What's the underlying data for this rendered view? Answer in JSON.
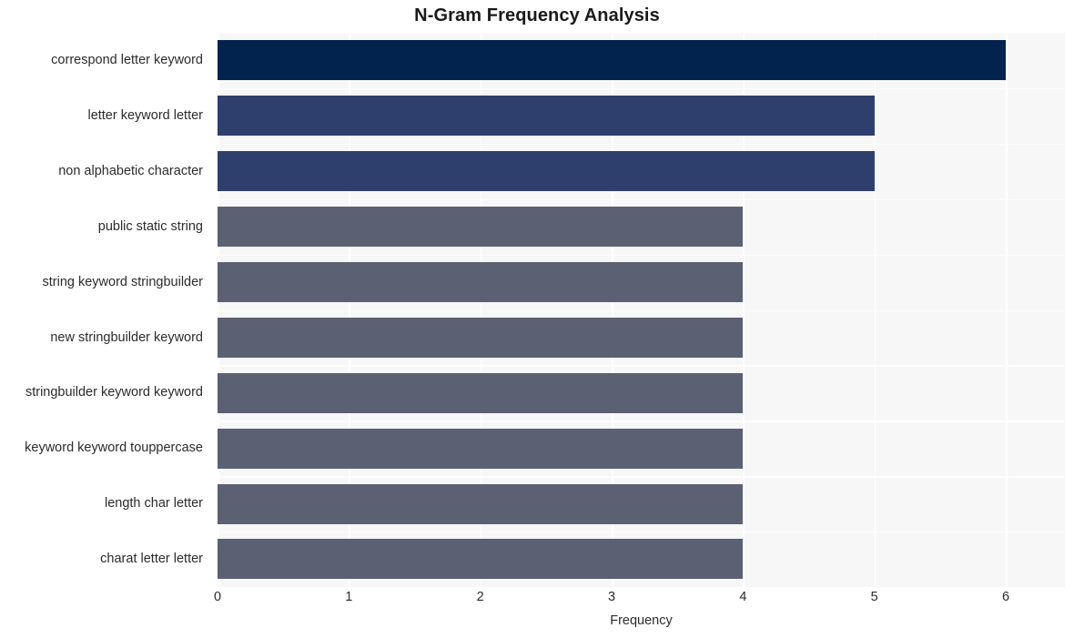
{
  "chart_data": {
    "type": "bar",
    "orientation": "horizontal",
    "title": "N-Gram Frequency Analysis",
    "xlabel": "Frequency",
    "ylabel": "",
    "categories": [
      "correspond letter keyword",
      "letter keyword letter",
      "non alphabetic character",
      "public static string",
      "string keyword stringbuilder",
      "new stringbuilder keyword",
      "stringbuilder keyword keyword",
      "keyword keyword touppercase",
      "length char letter",
      "charat letter letter"
    ],
    "values": [
      6,
      5,
      5,
      4,
      4,
      4,
      4,
      4,
      4,
      4
    ],
    "bar_colors": [
      "#03234f",
      "#2e3f6e",
      "#2e3f6e",
      "#5b6073",
      "#5b6073",
      "#5b6073",
      "#5b6073",
      "#5b6073",
      "#5b6073",
      "#5b6073"
    ],
    "xlim": [
      0,
      6.45
    ],
    "xticks": [
      0,
      1,
      2,
      3,
      4,
      5,
      6
    ],
    "xtick_labels": [
      "0",
      "1",
      "2",
      "3",
      "4",
      "5",
      "6"
    ],
    "grid": true,
    "grid_axis": "both",
    "grid_color": "#ffffff",
    "plot_background": "#f7f7f8",
    "figure_background": "#ffffff",
    "legend": null
  }
}
